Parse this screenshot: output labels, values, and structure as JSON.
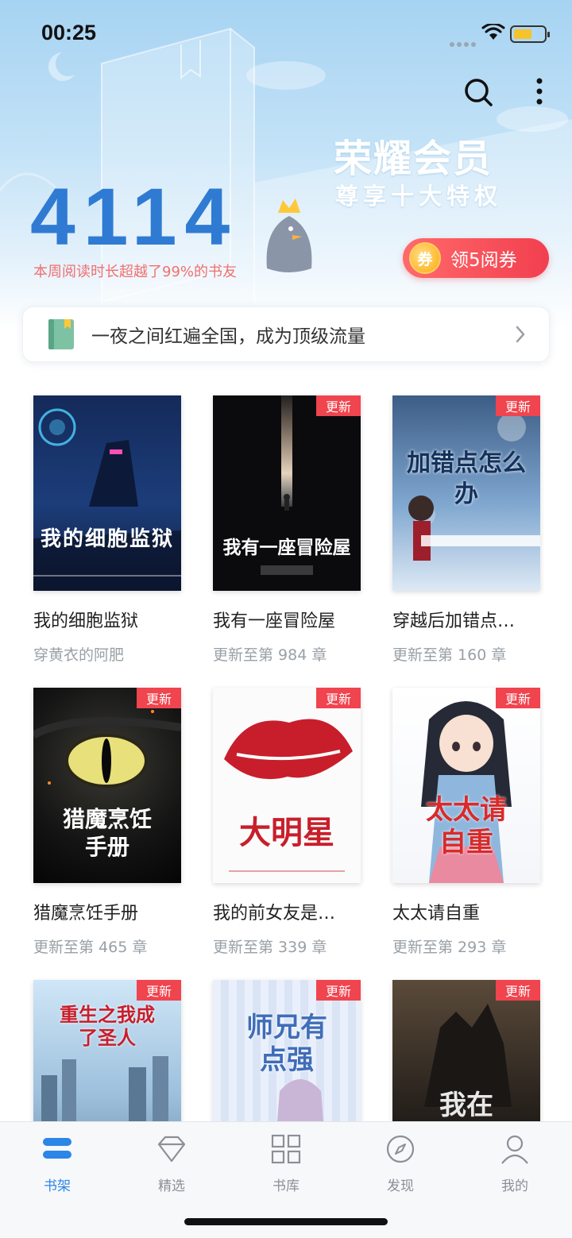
{
  "status_bar": {
    "time": "00:25"
  },
  "header": {
    "vip_title": "荣耀会员",
    "vip_subtitle": "尊享十大特权",
    "read_minutes": "4114",
    "rank_text": "本周阅读时长超越了99%的书友",
    "coupon_coin": "券",
    "coupon_label": "领5阅券"
  },
  "notice": {
    "text": "一夜之间红遍全国，成为顶级流量"
  },
  "books": [
    {
      "title": "我的细胞监狱",
      "sub": "穿黄衣的阿肥",
      "badge": "",
      "cover_text": "我的细胞监狱"
    },
    {
      "title": "我有一座冒险屋",
      "sub": "更新至第 984 章",
      "badge": "更新",
      "cover_text": "我有一座冒险屋"
    },
    {
      "title": "穿越后加错点…",
      "sub": "更新至第 160 章",
      "badge": "更新",
      "cover_text": "加错点怎么办"
    },
    {
      "title": "猎魔烹饪手册",
      "sub": "更新至第 465 章",
      "badge": "更新",
      "cover_text": "猎魔烹饪手册"
    },
    {
      "title": "我的前女友是…",
      "sub": "更新至第 339 章",
      "badge": "更新",
      "cover_text": "大明星"
    },
    {
      "title": "太太请自重",
      "sub": "更新至第 293 章",
      "badge": "更新",
      "cover_text": "太太请自重"
    },
    {
      "title": "",
      "sub": "",
      "badge": "更新",
      "cover_text": "重生之我成了圣人"
    },
    {
      "title": "",
      "sub": "",
      "badge": "更新",
      "cover_text": "师兄有点强"
    },
    {
      "title": "",
      "sub": "",
      "badge": "更新",
      "cover_text": "我在"
    }
  ],
  "tabs": [
    {
      "label": "书架",
      "icon": "bookshelf-icon",
      "active": true
    },
    {
      "label": "精选",
      "icon": "diamond-icon",
      "active": false
    },
    {
      "label": "书库",
      "icon": "grid-icon",
      "active": false
    },
    {
      "label": "发现",
      "icon": "compass-icon",
      "active": false
    },
    {
      "label": "我的",
      "icon": "profile-icon",
      "active": false
    }
  ],
  "colors": {
    "accent": "#2b86e6",
    "badge": "#f0444e",
    "coupon": "#f23f4f"
  }
}
